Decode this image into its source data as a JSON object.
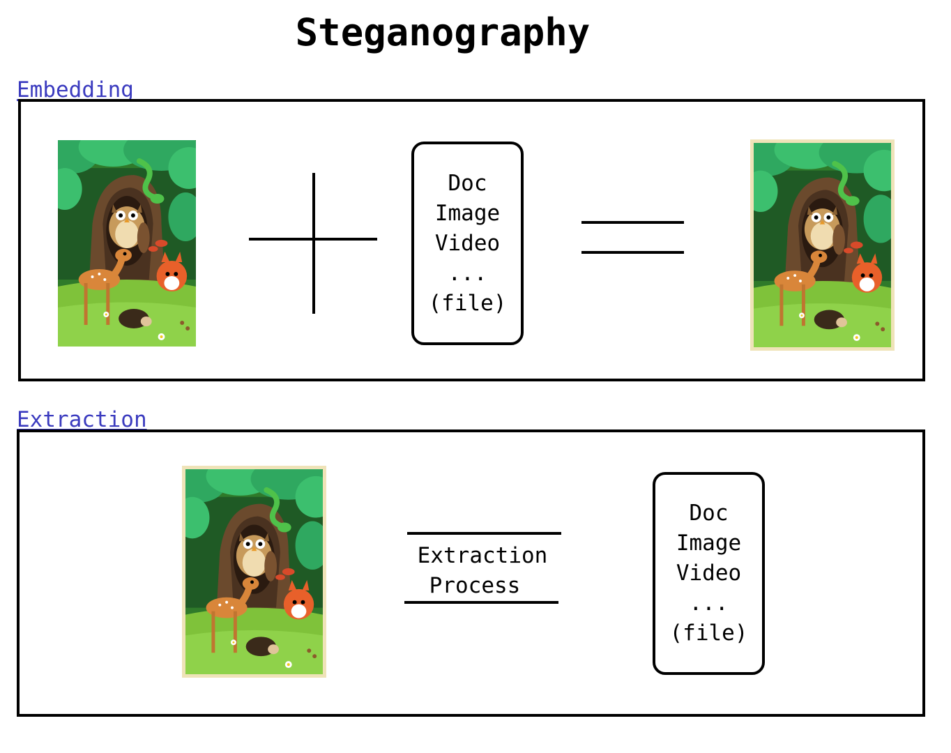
{
  "title": "Steganography",
  "colors": {
    "section_label": "#3b3bbf",
    "stego_frame": "#efe3b8",
    "line": "#000000"
  },
  "embedding": {
    "label": "Embedding",
    "cover_image": {
      "icon": "forest-animals-illustration"
    },
    "operator_plus": "plus-sign",
    "secret_file": {
      "lines": [
        "Doc",
        "Image",
        "Video",
        "...",
        "(file)"
      ]
    },
    "operator_equals": "equals-sign",
    "stego_image": {
      "icon": "forest-animals-illustration",
      "frame": "cream-border"
    }
  },
  "extraction": {
    "label": "Extraction",
    "stego_image": {
      "icon": "forest-animals-illustration",
      "frame": "cream-border"
    },
    "process": {
      "line1": "Extraction",
      "line2": "Process"
    },
    "recovered_file": {
      "lines": [
        "Doc",
        "Image",
        "Video",
        "...",
        "(file)"
      ]
    }
  }
}
